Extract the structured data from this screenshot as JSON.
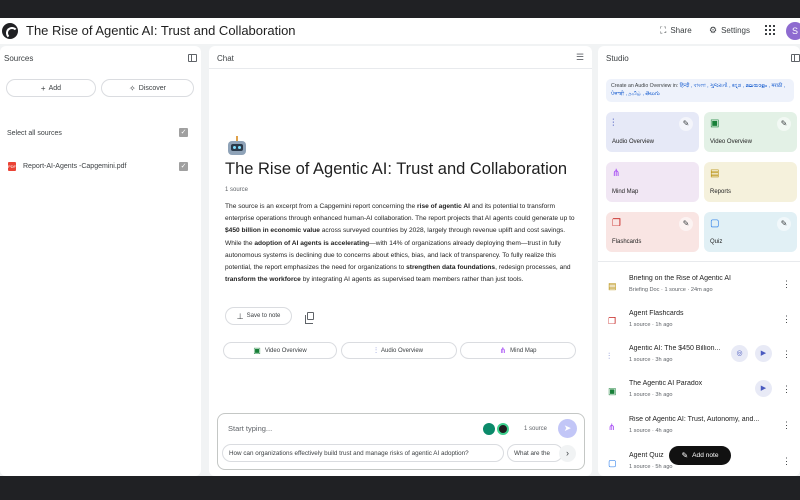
{
  "app": {
    "title": "The Rise of Agentic AI: Trust and Collaboration",
    "share_label": "Share",
    "settings_label": "Settings",
    "avatar_letter": "S"
  },
  "sources": {
    "title": "Sources",
    "add_label": "Add",
    "discover_label": "Discover",
    "select_all_label": "Select all sources",
    "items": [
      {
        "name": "Report-AI-Agents -Capgemini.pdf",
        "checked": true
      }
    ]
  },
  "chat": {
    "title": "Chat",
    "notebook_title": "The Rise of Agentic AI: Trust and Collaboration",
    "source_count": "1 source",
    "summary": {
      "p1": "The source is an excerpt from a Capgemini report concerning the ",
      "b1": "rise of agentic AI",
      "p2": " and its potential to transform enterprise operations through enhanced human-AI collaboration. The report projects that AI agents could generate up to ",
      "b2": "$450 billion in economic value",
      "p3": " across surveyed countries by 2028, largely through revenue uplift and cost savings. While the ",
      "b3": "adoption of AI agents is accelerating",
      "p4": "—with 14% of organizations already deploying them—trust in fully autonomous systems is declining due to concerns about ethics, bias, and lack of transparency. To fully realize this potential, the report emphasizes the need for organizations to ",
      "b4": "strengthen data foundations",
      "p5": ", redesign processes, and ",
      "b5": "transform the workforce",
      "p6": " by integrating AI agents as supervised team members rather than just tools."
    },
    "save_note_label": "Save to note",
    "chips": [
      "Video Overview",
      "Audio Overview",
      "Mind Map"
    ],
    "input_placeholder": "Start typing...",
    "input_source_count": "1 source",
    "suggestions": [
      "How can organizations effectively build trust and manage risks of agentic AI adoption?",
      "What are the"
    ]
  },
  "studio": {
    "title": "Studio",
    "banner_text": "Create an Audio Overview in: ",
    "banner_langs": "हिन्दी , বাংলা , ગુજરાતી , ಕನ್ನಡ , മലയാളം , मराठी , ਪੰਜਾਬੀ , தமிழ் , తెలుగు",
    "tiles": [
      {
        "label": "Audio Overview",
        "color": "#e6e9f7",
        "icon": "audio-waveform-icon"
      },
      {
        "label": "Video Overview",
        "color": "#e3f1e6",
        "icon": "video-icon"
      },
      {
        "label": "Mind Map",
        "color": "#f1e7f4",
        "icon": "mind-map-icon"
      },
      {
        "label": "Reports",
        "color": "#f5f1dc",
        "icon": "reports-icon"
      },
      {
        "label": "Flashcards",
        "color": "#f9e5e3",
        "icon": "flashcards-icon"
      },
      {
        "label": "Quiz",
        "color": "#e1f0f5",
        "icon": "quiz-icon"
      }
    ],
    "notes": [
      {
        "title": "Briefing on the Rise of Agentic AI",
        "meta": "Briefing Doc · 1 source · 24m ago",
        "icon": "briefing-doc-icon"
      },
      {
        "title": "Agent Flashcards",
        "meta": "1 source · 1h ago",
        "icon": "flashcards-icon"
      },
      {
        "title": "Agentic AI: The $450 Billion...",
        "meta": "1 source · 3h ago",
        "icon": "audio-waveform-icon"
      },
      {
        "title": "The Agentic AI Paradox",
        "meta": "1 source · 3h ago",
        "icon": "video-icon"
      },
      {
        "title": "Rise of Agentic AI: Trust, Autonomy, and...",
        "meta": "1 source · 4h ago",
        "icon": "mind-map-icon"
      },
      {
        "title": "Agent Quiz",
        "meta": "1 source · 5h ago",
        "icon": "quiz-icon"
      }
    ],
    "add_note_label": "Add note"
  }
}
